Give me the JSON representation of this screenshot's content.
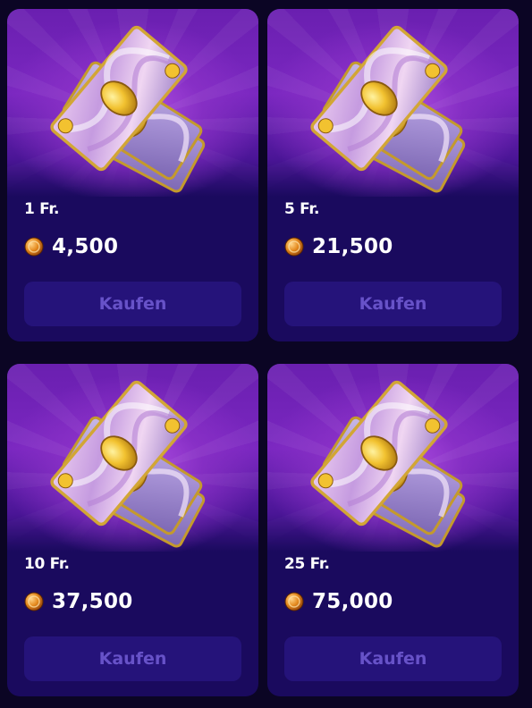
{
  "offers": [
    {
      "price": "1 Fr.",
      "amount": "4,500",
      "buy_label": "Kaufen",
      "icon": "coin-icon",
      "image": "banknotes-icon"
    },
    {
      "price": "5 Fr.",
      "amount": "21,500",
      "buy_label": "Kaufen",
      "icon": "coin-icon",
      "image": "banknotes-icon"
    },
    {
      "price": "10 Fr.",
      "amount": "37,500",
      "buy_label": "Kaufen",
      "icon": "coin-icon",
      "image": "banknotes-icon"
    },
    {
      "price": "25 Fr.",
      "amount": "75,000",
      "buy_label": "Kaufen",
      "icon": "coin-icon",
      "image": "banknotes-icon"
    }
  ],
  "colors": {
    "page_background": "#0b0524",
    "card_background": "#1a0a5e",
    "hero_purple": "#7a27c0",
    "button_background": "#25137a",
    "button_text": "#6752c8",
    "gold": "#f2c230"
  }
}
